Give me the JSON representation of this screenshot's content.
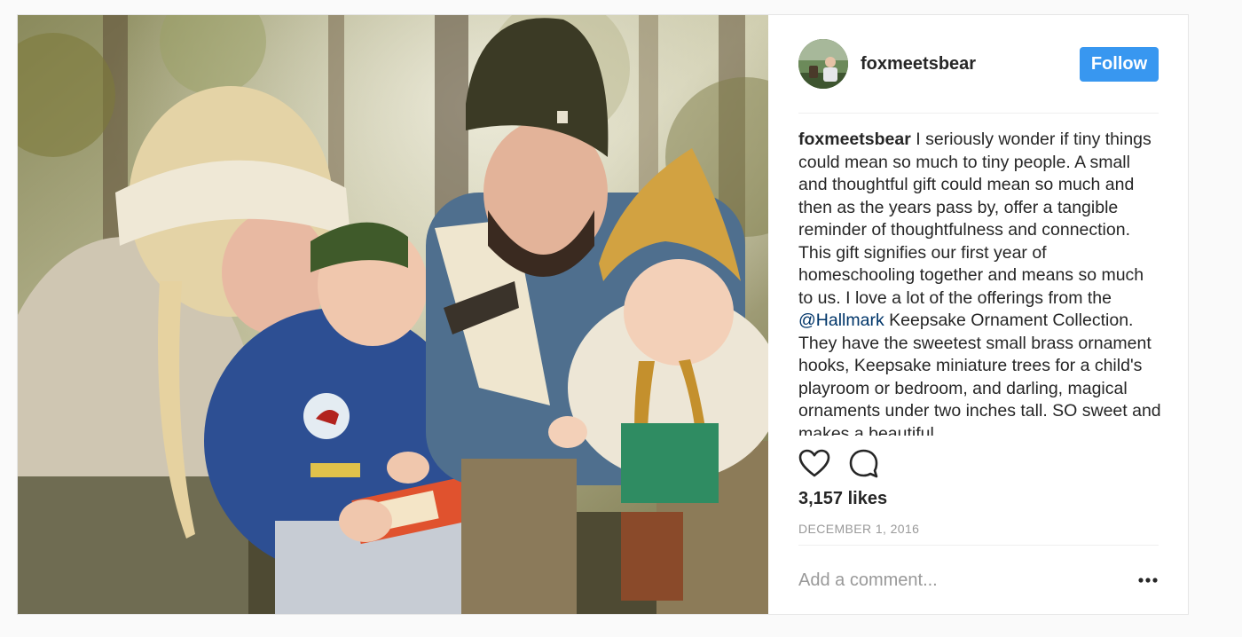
{
  "post": {
    "username": "foxmeetsbear",
    "follow_label": "Follow",
    "caption": {
      "username": "foxmeetsbear",
      "text_before_mention": " I seriously wonder if tiny things could mean so much to tiny people. A small and thoughtful gift could mean so much and then as the years pass by, offer a tangible reminder of thoughtfulness and connection. This gift signifies our first year of homeschooling together and means so much to us. I love a lot of the offerings from the ",
      "mention": "@Hallmark",
      "text_after_mention": " Keepsake Ornament Collection. They have the sweetest small brass ornament hooks, Keepsake miniature trees for a child's playroom or bedroom, and darling, magical ornaments under two inches tall. SO sweet and makes a beautiful"
    },
    "likes": "3,157 likes",
    "date": "DECEMBER 1, 2016",
    "comment_placeholder": "Add a comment..."
  },
  "icons": {
    "like": "heart-icon",
    "comment": "comment-bubble-icon",
    "more": "more-options-icon"
  },
  "colors": {
    "follow_button": "#3897f0",
    "mention": "#003569",
    "text": "#262626",
    "muted": "#999999"
  }
}
